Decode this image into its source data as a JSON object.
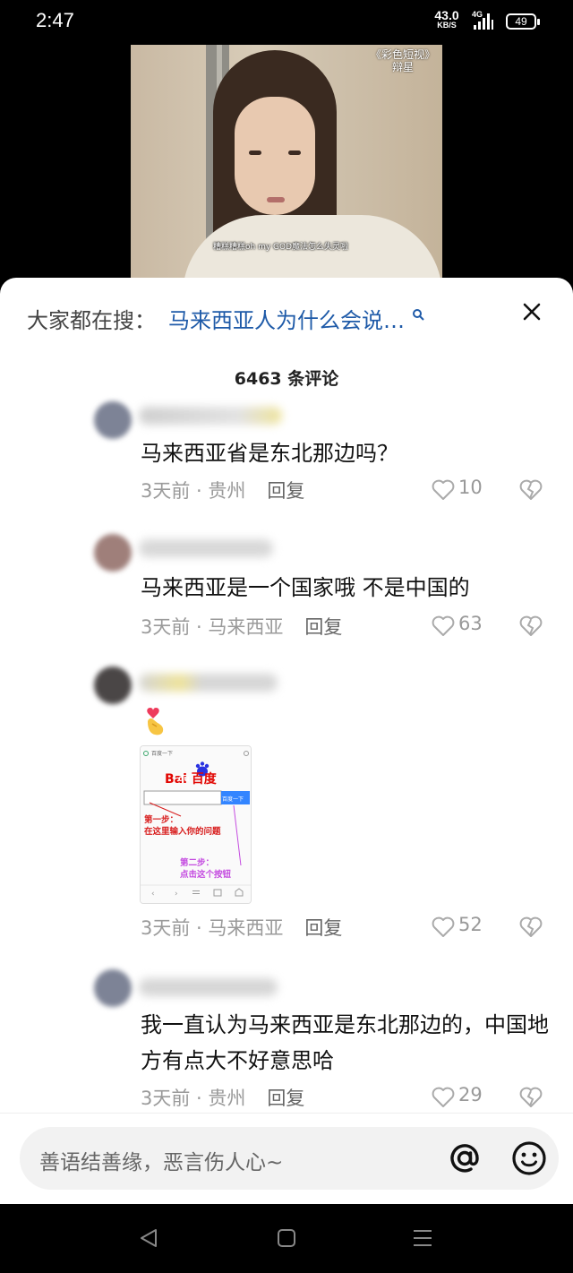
{
  "status_bar": {
    "time": "2:47",
    "speed_value": "43.0",
    "speed_unit": "KB/S",
    "network": "4G",
    "battery": "49"
  },
  "video": {
    "watermark_line1": "《彩色短视》",
    "watermark_line2": "辩星",
    "subtitle": "糟糕糟糕oh my GOD魔法怎么失灵啦"
  },
  "search_suggest": {
    "prefix": "大家都在搜：",
    "query": "马来西亚人为什么会说…"
  },
  "comments_header": {
    "count_text": "6463 条评论"
  },
  "comments": [
    {
      "text": "马来西亚省是东北那边吗？",
      "time": "3天前",
      "location": "贵州",
      "reply_label": "回复",
      "likes": "10"
    },
    {
      "text": "马来西亚是一个国家哦 不是中国的",
      "time": "3天前",
      "location": "马来西亚",
      "reply_label": "回复",
      "likes": "63"
    },
    {
      "text": "",
      "time": "3天前",
      "location": "马来西亚",
      "reply_label": "回复",
      "likes": "52",
      "image": {
        "top_label": "百度一下",
        "logo_text_a": "Bai",
        "logo_text_b": "du",
        "logo_text_c": "百度",
        "button": "百度一下",
        "step1_title": "第一步：",
        "step1_body": "在这里输入你的问题",
        "step2_title": "第二步：",
        "step2_body": "点击这个按钮"
      }
    },
    {
      "text": "我一直认为马来西亚是东北那边的，中国地方有点大不好意思哈",
      "time": "3天前",
      "location": "贵州",
      "reply_label": "回复",
      "likes": "29"
    }
  ],
  "input_bar": {
    "placeholder": "善语结善缘，恶言伤人心~"
  },
  "colors": {
    "link_blue": "#1e5aa8",
    "meta_gray": "#9a9a9a"
  }
}
